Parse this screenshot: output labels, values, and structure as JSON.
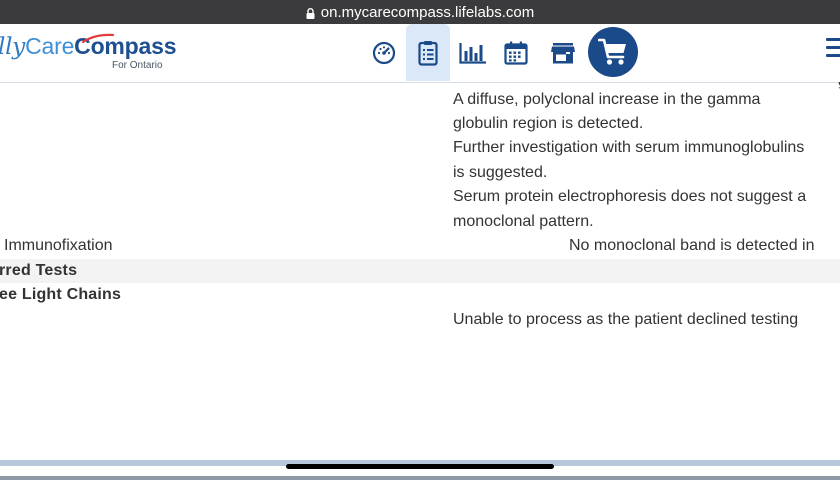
{
  "browser": {
    "url": "on.mycarecompass.lifelabs.com",
    "lock_icon": "lock-icon"
  },
  "header": {
    "logo": {
      "prefix": "lly",
      "care": "Care",
      "compass": "Compass",
      "subtitle": "For Ontario"
    },
    "nav_icons": [
      "dashboard-icon",
      "clipboard-results-icon",
      "bar-chart-icon",
      "calendar-icon",
      "store-icon",
      "shopping-cart-icon",
      "hamburger-menu-icon"
    ],
    "brand_color": "#1b4a8a",
    "active_tab_color": "#dbe8f7"
  },
  "results": {
    "interpretation_lines": [
      "A diffuse, polyclonal increase in the gamma",
      "globulin region is detected.",
      "Further investigation with serum immunoglobulins",
      "is suggested.",
      "Serum protein electrophoresis does not suggest a",
      "monoclonal pattern."
    ],
    "immunofixation": {
      "label": "Immunofixation",
      "value": "No monoclonal band is detected in"
    },
    "deferred_section": "rred Tests",
    "free_light_chains": {
      "label": "ee Light Chains",
      "value": "Unable to process as the patient declined testing"
    }
  }
}
